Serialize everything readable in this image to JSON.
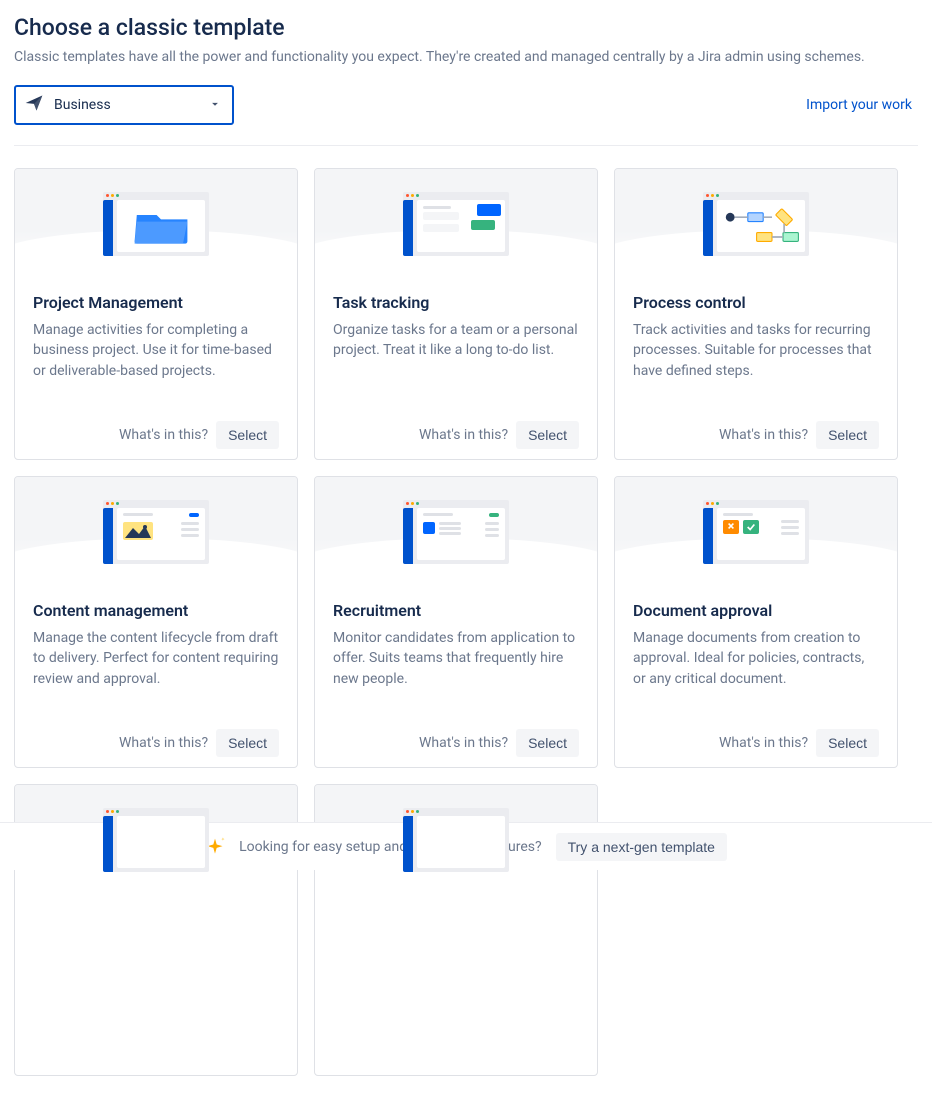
{
  "header": {
    "title": "Choose a classic template",
    "subtitle": "Classic templates have all the power and functionality you expect. They're created and managed centrally by a Jira admin using schemes."
  },
  "toolbar": {
    "category_label": "Business",
    "import_link": "Import your work"
  },
  "actions": {
    "whats_in_this": "What's in this?",
    "select": "Select"
  },
  "templates": [
    {
      "title": "Project Management",
      "desc": "Manage activities for completing a business project. Use it for time-based or deliverable-based projects."
    },
    {
      "title": "Task tracking",
      "desc": "Organize tasks for a team or a personal project. Treat it like a long to-do list."
    },
    {
      "title": "Process control",
      "desc": "Track activities and tasks for recurring processes. Suitable for processes that have defined steps."
    },
    {
      "title": "Content management",
      "desc": "Manage the content lifecycle from draft to delivery. Perfect for content requiring review and approval."
    },
    {
      "title": "Recruitment",
      "desc": "Monitor candidates from application to offer. Suits teams that frequently hire new people."
    },
    {
      "title": "Document approval",
      "desc": "Manage documents from creation to approval. Ideal for policies, contracts, or any critical document."
    },
    {
      "title": "",
      "desc": ""
    },
    {
      "title": "",
      "desc": ""
    }
  ],
  "footer": {
    "prompt": "Looking for easy setup and reimagined features?",
    "cta": "Try a next-gen template"
  }
}
